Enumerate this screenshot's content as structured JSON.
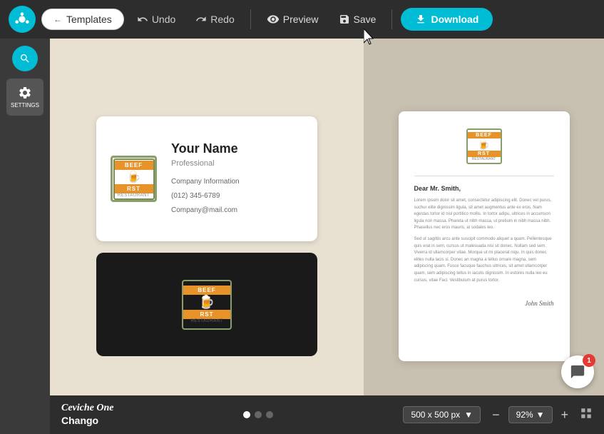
{
  "app": {
    "logo_color": "#00bcd4"
  },
  "toolbar": {
    "templates_label": "Templates",
    "undo_label": "Undo",
    "redo_label": "Redo",
    "preview_label": "Preview",
    "save_label": "Save",
    "download_label": "Download"
  },
  "sidebar": {
    "settings_label": "SETTINGS"
  },
  "cards": {
    "white_card": {
      "name": "Your Name",
      "title": "Professional",
      "company": "Company Information",
      "phone": "(012) 345-6789",
      "email": "Company@mail.com"
    },
    "logo": {
      "top_text": "BEEF",
      "bottom_text": "RST",
      "sub_text": "RESTAURANT"
    }
  },
  "document": {
    "greeting": "Dear Mr. Smith,",
    "body1": "Lorem ipsum dolor sit amet, consectetur adipiscing elit. Donec vel purus, suchur elite dignissim ligula, sit amet augmentus ante ex eros. Nam egestas tortor id nisl portitico mollis. In tortor adipu, ultrices in accumson ligula non massa. Phareta ut nibh massa, ut pretium in nibh massa nibh. Phasellus nec eros mauris, at sodales leo.",
    "body2": "Sed ut sagittis arcu ante suscipit commodo aliquet a quam. Pellentesque quis erat in sem, cursus ut malesuada nisi sit donec. Nullam sed sem. Viverra id ullamcorper vitae. Morque ut mi placerat niqu. In quis donec elites nulla lacis si. Donec an magna a tellus ornare magna, sem adipiscing quam. Fusce facuque fauchus ultrices, sit amet ullamcorper quam, sem adipiscing tellus in iaculis dignissim. In estores nulla leo eu cursus, vitae Faci. Vestibulum at purus tortor.",
    "signature": "John Smith"
  },
  "bottom_bar": {
    "font1": "Ceviche One",
    "font2": "Chango",
    "size": "500 x 500 px",
    "zoom": "92%",
    "dots": [
      "active",
      "inactive",
      "inactive"
    ]
  },
  "chat": {
    "badge": "1"
  }
}
